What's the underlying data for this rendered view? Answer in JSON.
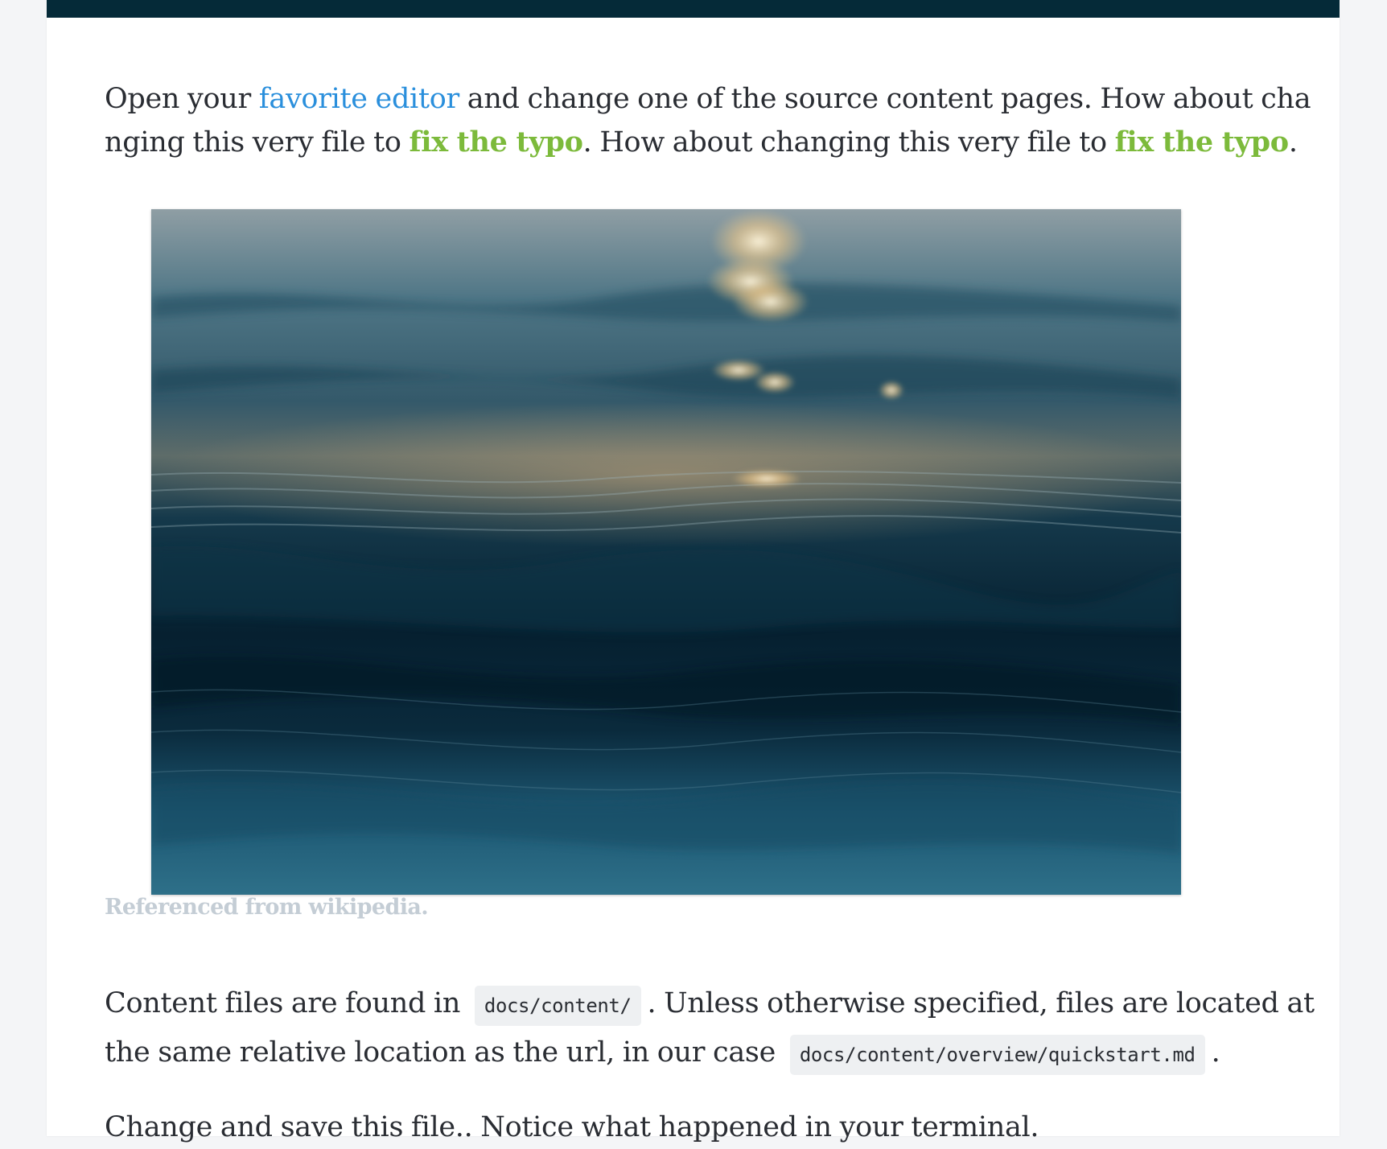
{
  "intro": {
    "text_1": "Open your ",
    "link_editor": "favorite editor",
    "text_2": " and change one of the source content pages. How about changing this very file to ",
    "link_typo_1": "fix the typo",
    "text_3": ". How about changing this very file to ",
    "link_typo_2": "fix the typo",
    "text_4": "."
  },
  "figure": {
    "image": "ocean-water-photo",
    "caption": "Referenced from wikipedia."
  },
  "content_para": {
    "text_1": "Content files are found in",
    "code_1": "docs/content/",
    "text_2": ". Unless otherwise specified, files are located at the same relative location as the url, in our case",
    "code_2": "docs/content/overview/quickstart.md",
    "text_3": "."
  },
  "final_para": {
    "text": "Change and save this file.. Notice what happened in your terminal."
  },
  "colors": {
    "topbar": "#052a38",
    "link": "#2a8fdc",
    "link_emphasis": "#7cba3b",
    "caption": "#c4cdd5",
    "code_bg": "#eef0f2"
  }
}
